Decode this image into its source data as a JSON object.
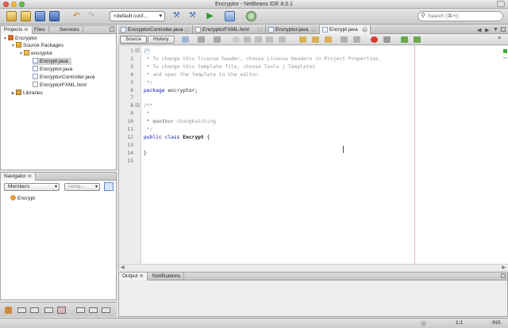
{
  "window": {
    "title": "Encryptor - NetBeans IDE 8.0.1"
  },
  "toolbar": {
    "config_value": "<default conf...",
    "search_placeholder": "Search (⌘+I)"
  },
  "projects_panel": {
    "tabs": [
      "Projects",
      "Files",
      "Services"
    ],
    "tree": [
      {
        "label": "Encryptor",
        "icon": "project-icon"
      },
      {
        "label": "Source Packages",
        "icon": "source-packages-icon"
      },
      {
        "label": "encryptor",
        "icon": "package-icon"
      },
      {
        "label": "Encrypt.java",
        "icon": "java-file-icon",
        "selected": true
      },
      {
        "label": "Encryptor.java",
        "icon": "java-file-icon"
      },
      {
        "label": "EncryptorController.java",
        "icon": "java-file-icon"
      },
      {
        "label": "EncryptorFXML.fxml",
        "icon": "fxml-file-icon"
      },
      {
        "label": "Libraries",
        "icon": "libraries-icon"
      }
    ]
  },
  "navigator": {
    "title": "Navigator",
    "filter_value": "Members",
    "empty_value": "<emp...",
    "items": [
      {
        "label": "Encrypt",
        "icon": "class-icon"
      }
    ]
  },
  "editor": {
    "tabs": [
      "EncryptorController.java",
      "EncryptorFXML.fxml",
      "Encryptor.java",
      "Encrypt.java"
    ],
    "active_tab": 3,
    "source_label": "Source",
    "history_label": "History",
    "line_numbers": [
      "1",
      "2",
      "3",
      "4",
      "5",
      "6",
      "7",
      "8",
      "9",
      "10",
      "11",
      "12",
      "13",
      "14",
      "15"
    ],
    "lines": {
      "l1": "/*",
      "l2": " * To change this license header, choose License Headers in Project Properties.",
      "l3": " * To change this template file, choose Tools | Templates",
      "l4": " * and open the template in the editor.",
      "l5": " */",
      "l6_kw": "package",
      "l6_rest": " encryptor;",
      "l8": "/**",
      "l9": " *",
      "l10_tag": " * @author",
      "l10_rest": " changkaiching",
      "l11": " */",
      "l12_kw": "public class",
      "l12_name": " Encrypt",
      "l12_rest": " {",
      "l14": "}"
    }
  },
  "output": {
    "tabs": [
      "Output",
      "Notifications"
    ]
  },
  "status": {
    "position": "1:1",
    "mode": "INS"
  },
  "colors": {
    "accent": "#3b78d8",
    "keyword": "#1111bb",
    "comment": "#969696",
    "margin_line": "#f2b8b8"
  }
}
